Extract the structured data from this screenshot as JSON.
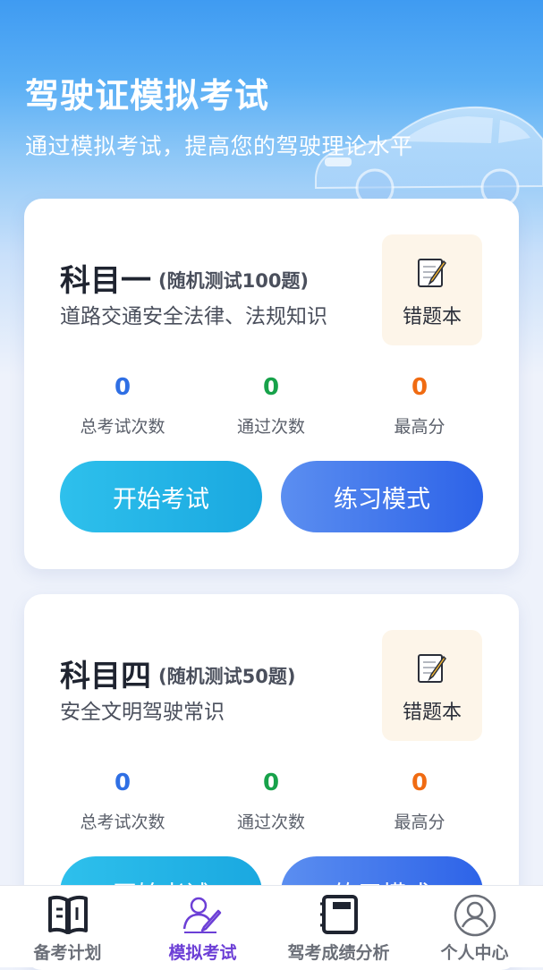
{
  "header": {
    "title": "驾驶证模拟考试",
    "subtitle": "通过模拟考试，提高您的驾驶理论水平"
  },
  "subjects": [
    {
      "name": "科目一",
      "note": "(随机测试100题)",
      "desc": "道路交通安全法律、法规知识",
      "wrong_book": "错题本",
      "stats": [
        {
          "value": "0",
          "label": "总考试次数"
        },
        {
          "value": "0",
          "label": "通过次数"
        },
        {
          "value": "0",
          "label": "最高分"
        }
      ],
      "start_label": "开始考试",
      "practice_label": "练习模式"
    },
    {
      "name": "科目四",
      "note": "(随机测试50题)",
      "desc": "安全文明驾驶常识",
      "wrong_book": "错题本",
      "stats": [
        {
          "value": "0",
          "label": "总考试次数"
        },
        {
          "value": "0",
          "label": "通过次数"
        },
        {
          "value": "0",
          "label": "最高分"
        }
      ],
      "start_label": "开始考试",
      "practice_label": "练习模式"
    }
  ],
  "tabbar": {
    "items": [
      {
        "label": "备考计划",
        "icon": "book-icon",
        "active": false
      },
      {
        "label": "模拟考试",
        "icon": "person-pen-icon",
        "active": true
      },
      {
        "label": "驾考成绩分析",
        "icon": "notebook-icon",
        "active": false
      },
      {
        "label": "个人中心",
        "icon": "user-icon",
        "active": false
      }
    ]
  },
  "colors": {
    "accent_active": "#6c3fd6",
    "stat_total": "#2f6fe4",
    "stat_pass": "#17a24a",
    "stat_best": "#f06b12"
  }
}
